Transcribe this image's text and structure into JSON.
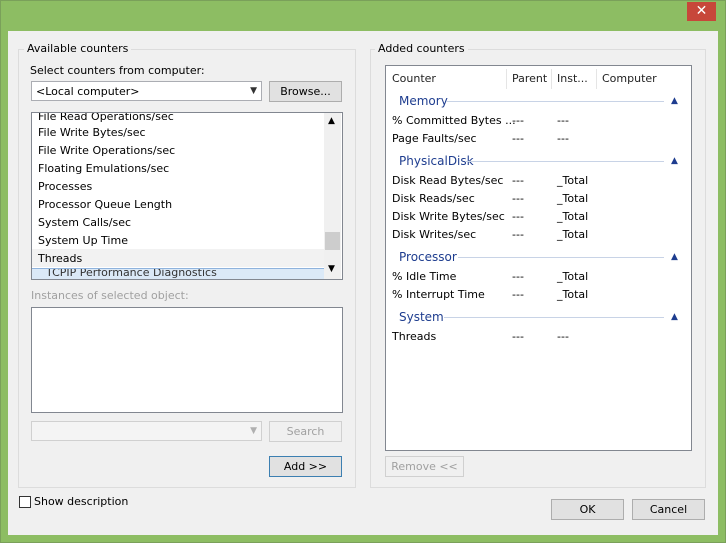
{
  "window": {
    "close_glyph": "✕"
  },
  "available": {
    "group_label": "Available counters",
    "select_label": "Select counters from computer:",
    "computer_value": "<Local computer>",
    "browse_label": "Browse...",
    "counters": [
      "File Read Operations/sec",
      "File Write Bytes/sec",
      "File Write Operations/sec",
      "Floating Emulations/sec",
      "Processes",
      "Processor Queue Length",
      "System Calls/sec",
      "System Up Time",
      "Threads",
      "TCPIP Performance Diagnostics"
    ],
    "selected_counter": "Threads",
    "instances_label": "Instances of selected object:",
    "search_value": "",
    "search_label": "Search",
    "add_label": "Add >>"
  },
  "added": {
    "group_label": "Added counters",
    "headers": {
      "counter": "Counter",
      "parent": "Parent",
      "instance": "Inst...",
      "computer": "Computer"
    },
    "categories": [
      {
        "name": "Memory",
        "rows": [
          {
            "counter": "% Committed Bytes ...",
            "parent": "---",
            "instance": "---"
          },
          {
            "counter": "Page Faults/sec",
            "parent": "---",
            "instance": "---"
          }
        ]
      },
      {
        "name": "PhysicalDisk",
        "rows": [
          {
            "counter": "Disk Read Bytes/sec",
            "parent": "---",
            "instance": "_Total"
          },
          {
            "counter": "Disk Reads/sec",
            "parent": "---",
            "instance": "_Total"
          },
          {
            "counter": "Disk Write Bytes/sec",
            "parent": "---",
            "instance": "_Total"
          },
          {
            "counter": "Disk Writes/sec",
            "parent": "---",
            "instance": "_Total"
          }
        ]
      },
      {
        "name": "Processor",
        "rows": [
          {
            "counter": "% Idle Time",
            "parent": "---",
            "instance": "_Total"
          },
          {
            "counter": "% Interrupt Time",
            "parent": "---",
            "instance": "_Total"
          }
        ]
      },
      {
        "name": "System",
        "rows": [
          {
            "counter": "Threads",
            "parent": "---",
            "instance": "---"
          }
        ]
      }
    ],
    "remove_label": "Remove <<"
  },
  "footer": {
    "show_description_label": "Show description",
    "ok_label": "OK",
    "cancel_label": "Cancel"
  },
  "colors": {
    "frame": "#8dbd63",
    "close": "#c7473a",
    "category": "#1e3d8f"
  }
}
